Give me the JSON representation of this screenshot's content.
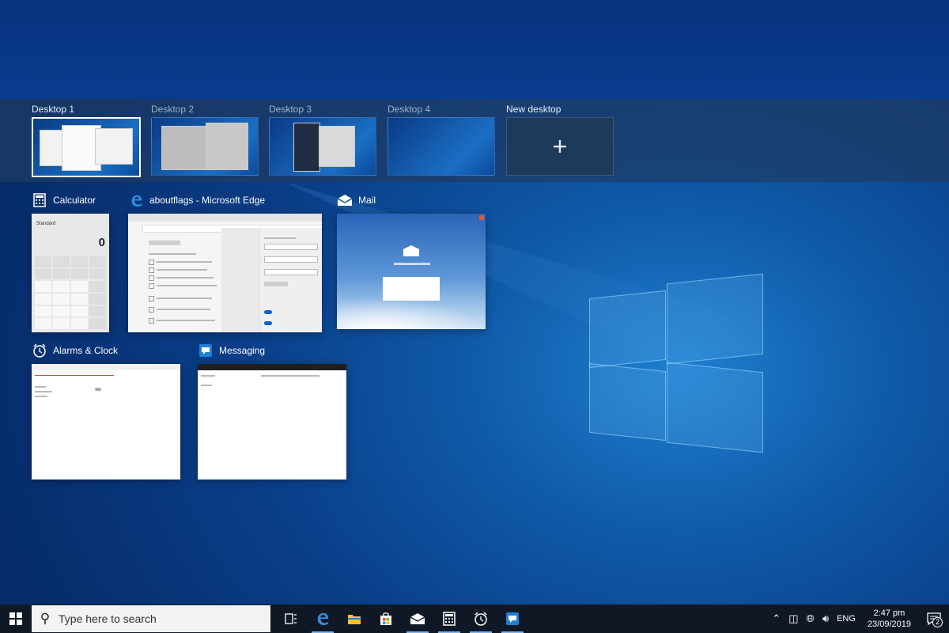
{
  "virtual_desktops": [
    {
      "label": "Desktop 1",
      "active": true
    },
    {
      "label": "Desktop 2",
      "active": false
    },
    {
      "label": "Desktop 3",
      "active": false
    },
    {
      "label": "Desktop 4",
      "active": false
    }
  ],
  "new_desktop": {
    "label": "New desktop",
    "icon": "plus-icon"
  },
  "windows": [
    {
      "title": "Calculator",
      "icon": "calculator-icon"
    },
    {
      "title": "aboutflags - Microsoft Edge",
      "icon": "edge-icon"
    },
    {
      "title": "Mail",
      "icon": "mail-icon"
    },
    {
      "title": "Alarms & Clock",
      "icon": "alarm-clock-icon"
    },
    {
      "title": "Messaging",
      "icon": "messaging-icon"
    }
  ],
  "calculator_preview": {
    "mode": "Standard",
    "display": "0"
  },
  "taskbar": {
    "search_placeholder": "Type here to search",
    "apps": [
      "task-view-icon",
      "edge-icon",
      "file-explorer-icon",
      "store-icon",
      "mail-icon",
      "calculator-icon",
      "alarm-clock-icon",
      "messaging-icon"
    ]
  },
  "tray": {
    "language": "ENG",
    "time": "2:47 pm",
    "date": "23/09/2019",
    "notification_count": "2"
  },
  "colors": {
    "accent": "#0078d7",
    "taskbar": "#101826",
    "desktop": "#0a4a9a"
  }
}
